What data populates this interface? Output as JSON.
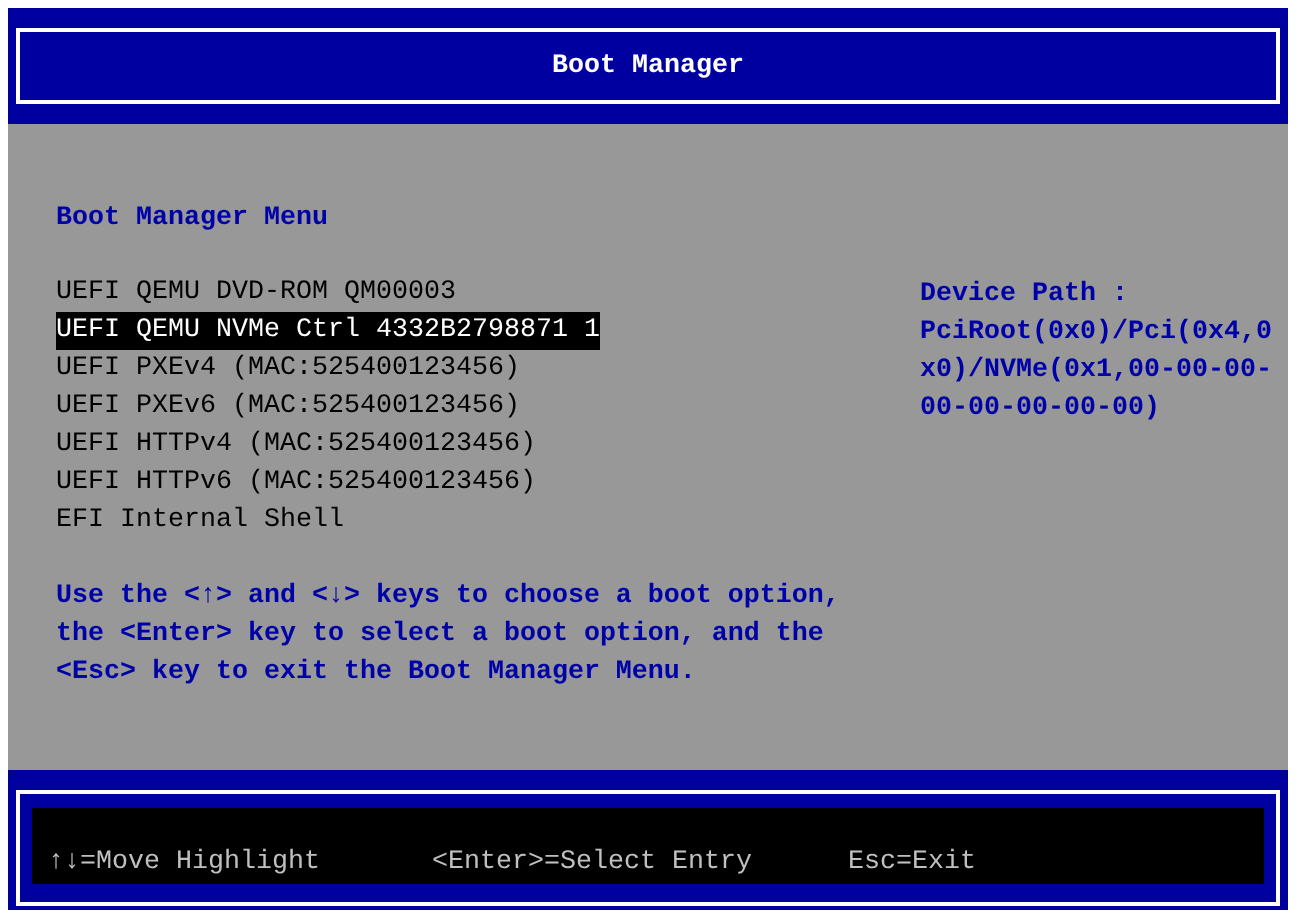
{
  "title": "Boot Manager",
  "menu": {
    "heading": "Boot Manager Menu",
    "items": [
      {
        "label": "UEFI QEMU DVD-ROM QM00003",
        "selected": false
      },
      {
        "label": "UEFI QEMU NVMe Ctrl 4332B2798871 1",
        "selected": true
      },
      {
        "label": "UEFI PXEv4 (MAC:525400123456)",
        "selected": false
      },
      {
        "label": "UEFI PXEv6 (MAC:525400123456)",
        "selected": false
      },
      {
        "label": "UEFI HTTPv4 (MAC:525400123456)",
        "selected": false
      },
      {
        "label": "UEFI HTTPv6 (MAC:525400123456)",
        "selected": false
      },
      {
        "label": "EFI Internal Shell",
        "selected": false
      }
    ],
    "help_lines": [
      "Use the <↑> and <↓> keys to choose a boot option,",
      "the <Enter> key to select a boot option, and the",
      "<Esc> key to exit the Boot Manager Menu."
    ]
  },
  "device_path": {
    "label": "Device Path :",
    "value": "PciRoot(0x0)/Pci(0x4,0x0)/NVMe(0x1,00-00-00-00-00-00-00-00)"
  },
  "status_bar": [
    "↑↓=Move Highlight",
    "<Enter>=Select Entry",
    "Esc=Exit"
  ]
}
